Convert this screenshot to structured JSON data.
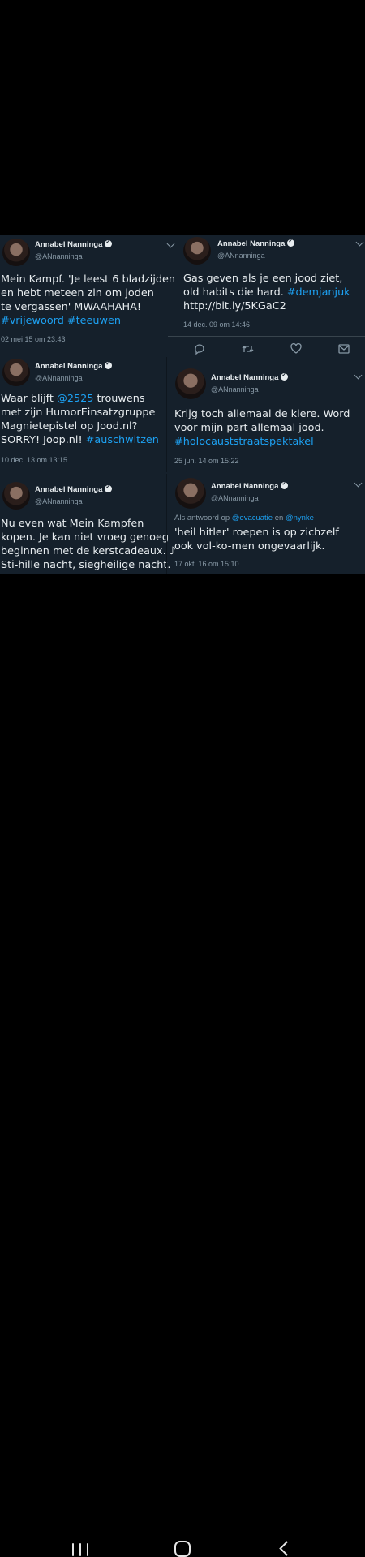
{
  "tweets": [
    {
      "name": "Annabel Nanninga",
      "handle": "@ANnanninga",
      "lines": [
        "Mein Kampf. 'Je leest 6 bladzijden",
        "en hebt meteen zin om joden",
        "te vergassen' MWAAHAHA!"
      ],
      "tags_line": [
        "#vrijewoord",
        "#teeuwen"
      ],
      "timestamp": "02 mei 15 om 23:43"
    },
    {
      "name": "Annabel Nanninga",
      "handle": "@ANnanninga",
      "line1": "Gas geven als je een jood ziet,",
      "line2_text": "old habits die hard. ",
      "line2_tag": "#demjanjuk",
      "line3": "http://bit.ly/5KGaC2",
      "timestamp": "14 dec. 09 om 14:46"
    },
    {
      "name": "Annabel Nanninga",
      "handle": "@ANnanninga",
      "line1_text": "Waar blijft ",
      "line1_mention": "@2525",
      "line1_rest": " trouwens",
      "line2": "met zijn HumorEinsatzgruppe",
      "line3": "Magnietepistel op Jood.nl?",
      "line4_text": "SORRY! Joop.nl! ",
      "line4_tag": "#auschwitzen",
      "timestamp": "10 dec. 13 om 13:15"
    },
    {
      "name": "Annabel Nanninga",
      "handle": "@ANnanninga",
      "line1": "Krijg toch allemaal de klere. Word",
      "line2": "voor mijn part allemaal jood.",
      "line3_tag": "#holocauststraatspektakel",
      "timestamp": "25 jun. 14 om 15:22"
    },
    {
      "name": "Annabel Nanninga",
      "handle": "@ANnanninga",
      "lines": [
        "Nu even wat Mein Kampfen",
        "kopen. Je kan niet vroeg genoeg",
        "beginnen met de kerstcadeaux. ♪",
        "Sti-hille nacht, siegheilige nacht."
      ]
    },
    {
      "name": "Annabel Nanninga",
      "handle": "@ANnanninga",
      "reply_prefix": "Als antwoord op ",
      "reply_mention1": "@evacuatie",
      "reply_and": " en ",
      "reply_mention2": "@nynke",
      "lines": [
        "'heil hitler' roepen is op zichzelf",
        "ook vol-ko-men ongevaarlijk."
      ],
      "timestamp": "17 okt. 16 om 15:10"
    }
  ],
  "icons": {
    "verified": "verified-badge-icon",
    "menu": "chevron-down-icon",
    "reply": "reply-icon",
    "retweet": "retweet-icon",
    "like": "like-icon",
    "share": "share-icon",
    "nav_recents": "recents-icon",
    "nav_home": "home-icon",
    "nav_back": "back-icon"
  },
  "colors": {
    "background": "#15202b",
    "link": "#1da1f2",
    "secondary": "#8899a6",
    "text": "#e7ecef"
  }
}
